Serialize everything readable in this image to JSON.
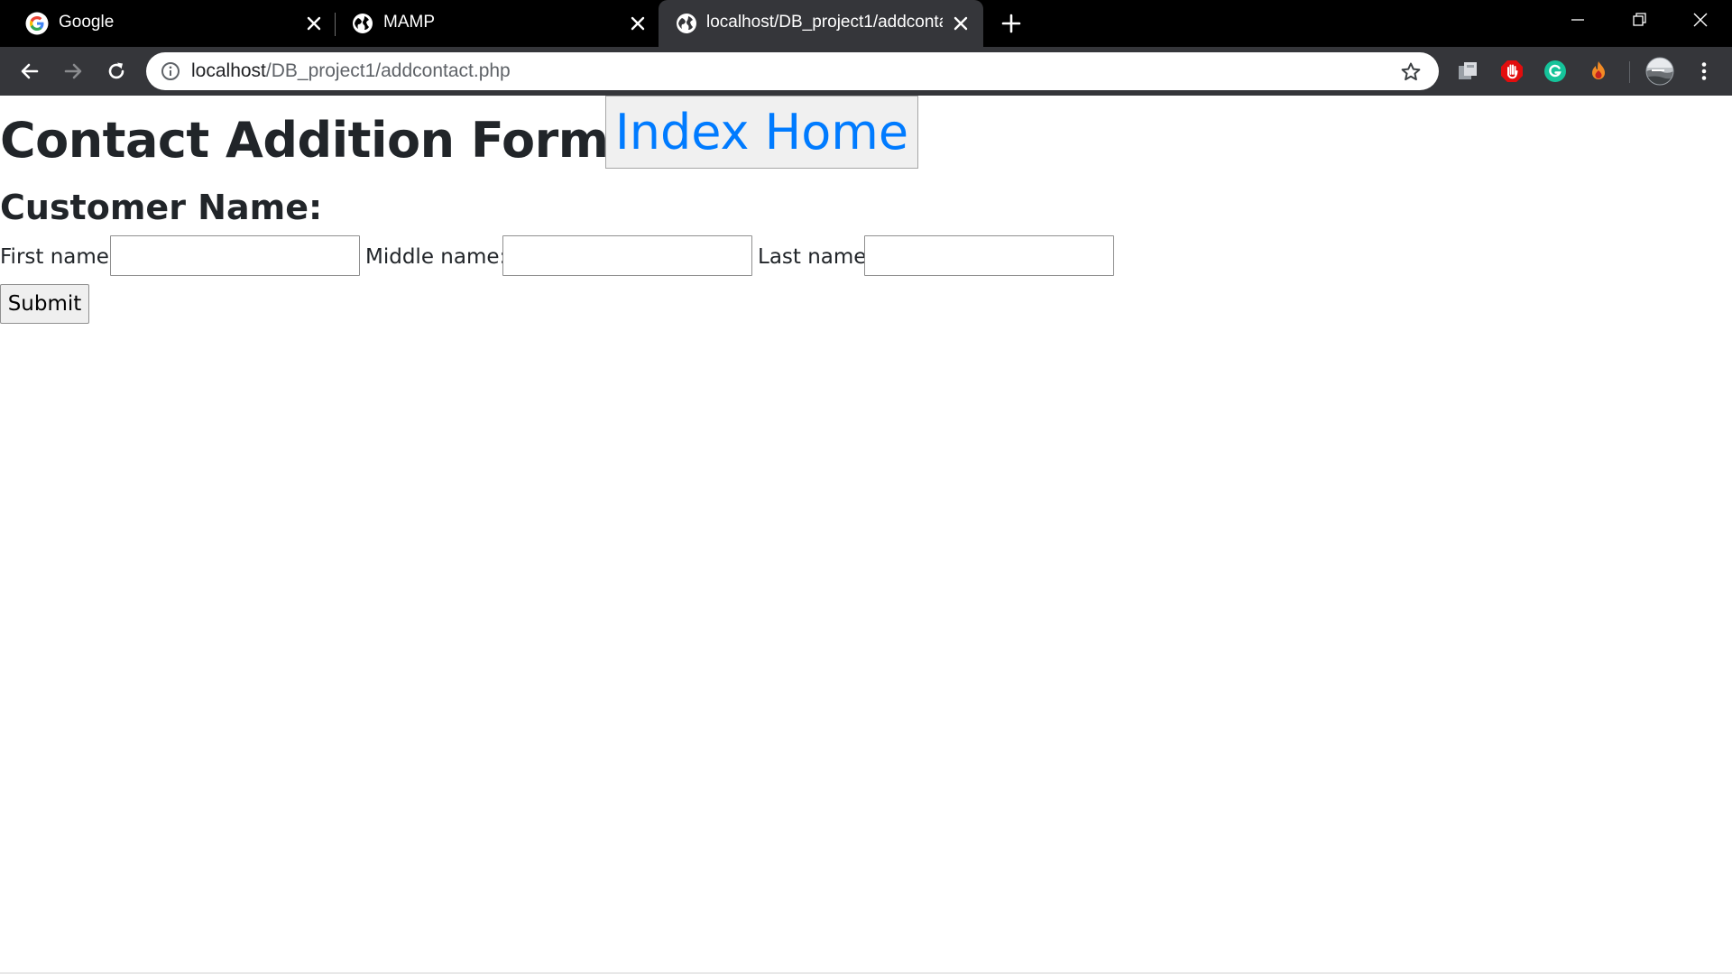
{
  "browser": {
    "tabs": [
      {
        "title": "Google",
        "favicon": "google-g-icon",
        "active": false
      },
      {
        "title": "MAMP",
        "favicon": "globe-icon",
        "active": false
      },
      {
        "title": "localhost/DB_project1/addcontac",
        "favicon": "globe-icon",
        "active": true
      }
    ],
    "address_bar": {
      "host": "localhost",
      "path": "/DB_project1/addcontact.php"
    },
    "extensions": [
      "extension-puzzle-icon",
      "adblock-stop-hand-icon",
      "grammarly-g-icon",
      "fire-extension-icon"
    ],
    "colors": {
      "tab_strip": "#000000",
      "toolbar": "#35363a",
      "omnibox": "#ffffff"
    }
  },
  "page": {
    "title": "Contact Addition Form",
    "home_link_label": "Index Home",
    "section_heading": "Customer Name:",
    "fields": [
      {
        "label": "First name:",
        "value": ""
      },
      {
        "label": "Middle name:",
        "value": ""
      },
      {
        "label": "Last name:",
        "value": ""
      }
    ],
    "submit_label": "Submit",
    "colors": {
      "text": "#212529",
      "link": "#007bff"
    }
  }
}
